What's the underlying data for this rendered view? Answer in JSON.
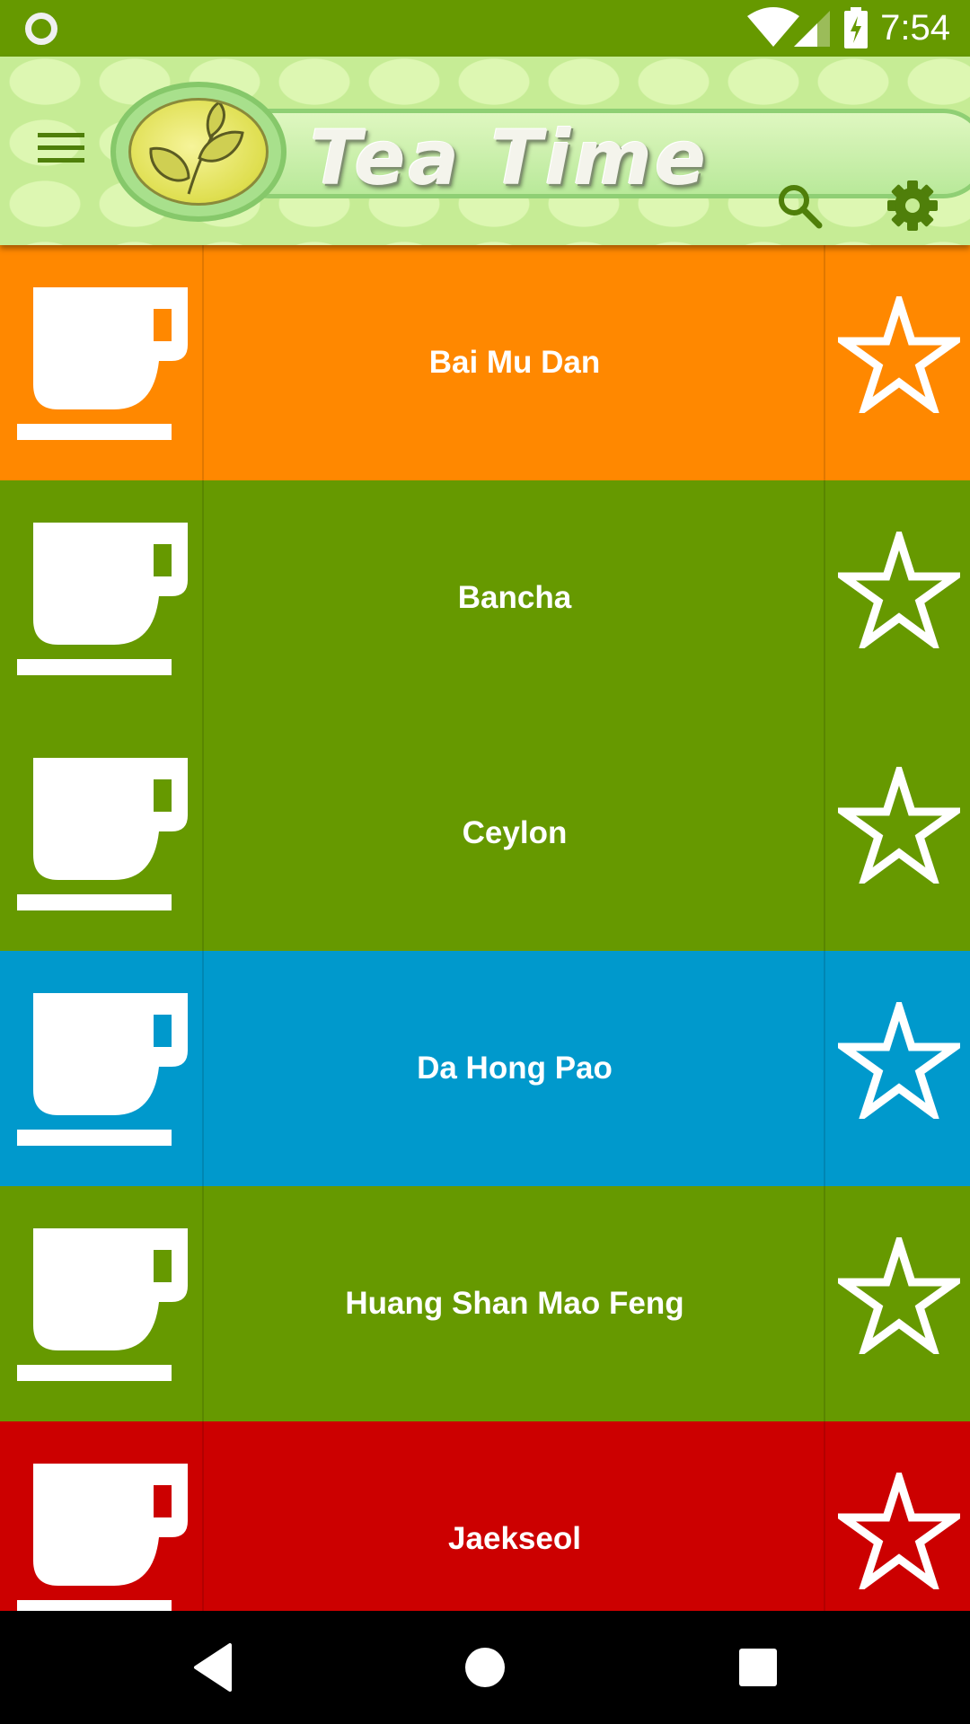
{
  "status_bar": {
    "time": "7:54",
    "icons": [
      "notification-ring-icon",
      "wifi-icon",
      "cell-signal-icon",
      "battery-charging-icon"
    ]
  },
  "header": {
    "title": "Tea Time",
    "icons": [
      "menu-icon",
      "tea-leaf-logo",
      "search-icon",
      "gear-icon"
    ],
    "colors": {
      "accent": "#669900",
      "header_bg": "#c6ec95"
    }
  },
  "teas": [
    {
      "name": "Bai Mu Dan",
      "color": "#ff8800"
    },
    {
      "name": "Bancha",
      "color": "#669900"
    },
    {
      "name": "Ceylon",
      "color": "#669900"
    },
    {
      "name": "Da Hong Pao",
      "color": "#0099cc"
    },
    {
      "name": "Huang Shan Mao Feng",
      "color": "#669900"
    },
    {
      "name": "Jaekseol",
      "color": "#cc0000"
    }
  ],
  "row_icons": {
    "left": "tea-cup-icon",
    "right": "star-outline-icon"
  },
  "nav_bar": {
    "icons": [
      "back-icon",
      "home-icon",
      "recents-icon"
    ]
  }
}
